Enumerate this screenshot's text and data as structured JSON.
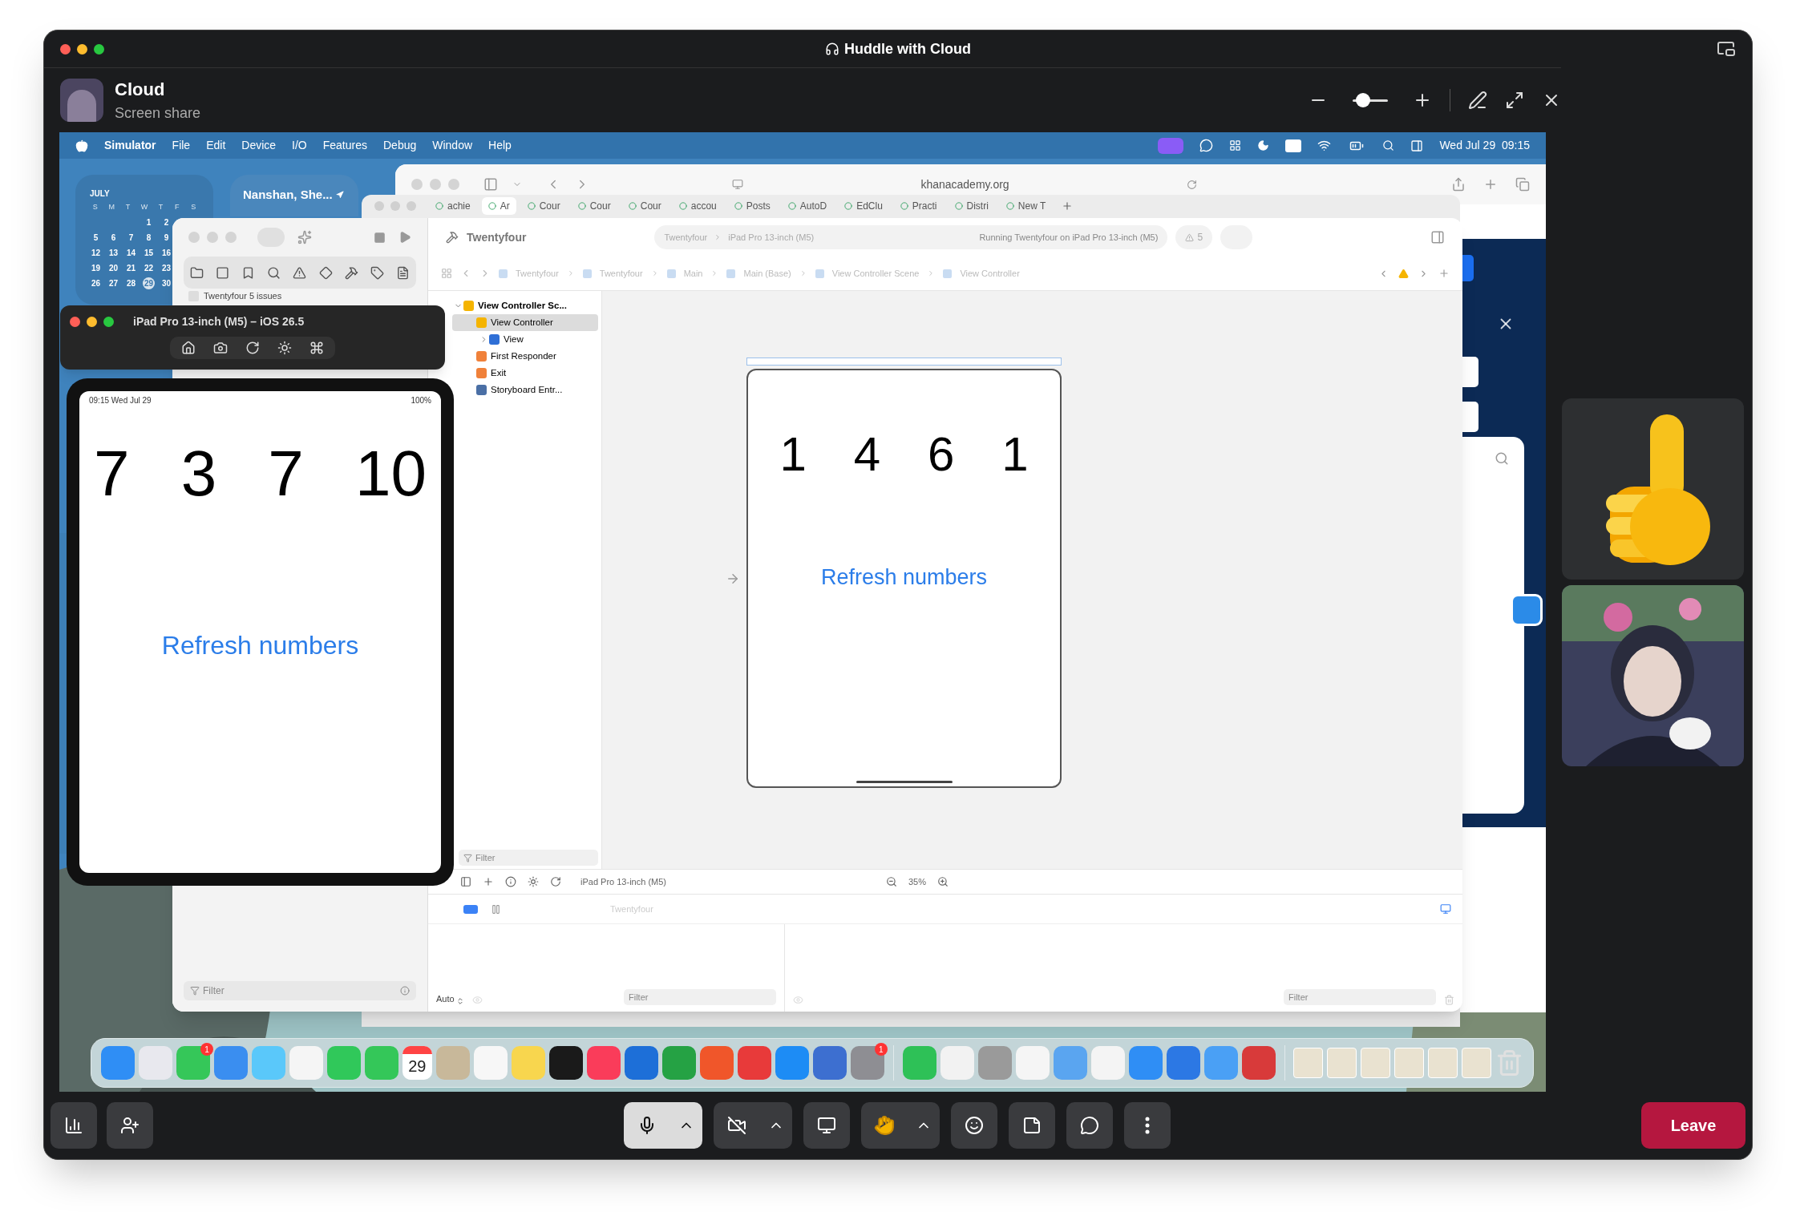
{
  "window": {
    "title": "Huddle with Cloud"
  },
  "presenter": {
    "name": "Cloud",
    "status": "Screen share"
  },
  "zoom_slider": {
    "level": 0.3
  },
  "shared_screen": {
    "menu_bar": {
      "app": "Simulator",
      "menus": [
        "File",
        "Edit",
        "Device",
        "I/O",
        "Features",
        "Debug",
        "Window",
        "Help"
      ],
      "clock": "Wed Jul 29  09:15"
    },
    "calendar_widget": {
      "month": "JULY",
      "weekdays": [
        "S",
        "M",
        "T",
        "W",
        "T",
        "F",
        "S"
      ],
      "weeks": [
        [
          {
            "day": "1",
            "selected": false
          },
          {
            "day": "2",
            "selected": false
          }
        ],
        [
          {
            "day": "5",
            "selected": false
          },
          {
            "day": "6",
            "selected": false
          },
          {
            "day": "7",
            "selected": false
          },
          {
            "day": "8",
            "selected": false
          },
          {
            "day": "9",
            "selected": false
          }
        ],
        [
          {
            "day": "12",
            "selected": false
          },
          {
            "day": "13",
            "selected": false
          },
          {
            "day": "14",
            "selected": false
          },
          {
            "day": "15",
            "selected": false
          },
          {
            "day": "16",
            "selected": false
          }
        ],
        [
          {
            "day": "19",
            "selected": false
          },
          {
            "day": "20",
            "selected": false
          },
          {
            "day": "21",
            "selected": false
          },
          {
            "day": "22",
            "selected": false
          },
          {
            "day": "23",
            "selected": false
          }
        ],
        [
          {
            "day": "26",
            "selected": false
          },
          {
            "day": "27",
            "selected": false
          },
          {
            "day": "28",
            "selected": false
          },
          {
            "day": "29",
            "selected": true
          },
          {
            "day": "30",
            "selected": false
          }
        ]
      ]
    },
    "weather_widget": {
      "location": "Nanshan, She..."
    },
    "safari": {
      "url": "khanacademy.org"
    },
    "tab_window": {
      "tabs": [
        {
          "label": "achie",
          "selected": false
        },
        {
          "label": "Ar",
          "selected": true
        },
        {
          "label": "Cour",
          "selected": false
        },
        {
          "label": "Cour",
          "selected": false
        },
        {
          "label": "Cour",
          "selected": false
        },
        {
          "label": "accou",
          "selected": false
        },
        {
          "label": "Posts",
          "selected": false
        },
        {
          "label": "AutoD",
          "selected": false
        },
        {
          "label": "EdClu",
          "selected": false
        },
        {
          "label": "Practi",
          "selected": false
        },
        {
          "label": "Distri",
          "selected": false
        },
        {
          "label": "New T",
          "selected": false
        }
      ]
    },
    "xcode": {
      "project": "Twentyfour",
      "scheme": "Twentyfour",
      "device": "iPad Pro 13-inch (M5)",
      "status": "Running Twentyfour on iPad Pro 13-inch (M5)",
      "warnings": "5",
      "issues": {
        "project": "Twentyfour",
        "summary": "5 issues"
      },
      "breadcrumbs": [
        "Twentyfour",
        "Twentyfour",
        "Main",
        "Main (Base)",
        "View Controller Scene",
        "View Controller"
      ],
      "outline": [
        {
          "label": "View Controller Sc...",
          "kind": "scene",
          "expanded": true,
          "selected": false,
          "children": [
            {
              "label": "View Controller",
              "kind": "controller",
              "selected": true,
              "children": [
                {
                  "label": "View",
                  "kind": "view",
                  "expanded": false,
                  "selected": false
                }
              ]
            },
            {
              "label": "First Responder",
              "kind": "responder",
              "selected": false
            },
            {
              "label": "Exit",
              "kind": "exit",
              "selected": false
            },
            {
              "label": "Storyboard Entr...",
              "kind": "entry",
              "selected": false
            }
          ]
        }
      ],
      "outline_filter": "Filter",
      "canvas": {
        "numbers": [
          "1",
          "4",
          "6",
          "1"
        ],
        "button": "Refresh numbers"
      },
      "canvas_bar": {
        "device": "iPad Pro 13-inch (M5)",
        "zoom": "35%"
      },
      "debug_bar": {
        "breakpoints_on": true,
        "target": "Twentyfour"
      },
      "debug_footer": {
        "mode": "Auto",
        "variables_filter": "Filter",
        "console_filter": "Filter"
      },
      "navigator_filter": "Filter"
    },
    "simulator": {
      "title": "iPad Pro 13-inch (M5) – iOS 26.5",
      "time": "09:15",
      "date": "Wed Jul 29",
      "battery": "100%",
      "numbers": [
        "7",
        "3",
        "7",
        "10"
      ],
      "button": "Refresh numbers"
    },
    "dock": {
      "apps": [
        {
          "kind": "app"
        },
        {
          "kind": "app"
        },
        {
          "kind": "app",
          "badge": "1"
        },
        {
          "kind": "app"
        },
        {
          "kind": "app"
        },
        {
          "kind": "app"
        },
        {
          "kind": "app"
        },
        {
          "kind": "app"
        },
        {
          "kind": "calendar",
          "day": "29"
        },
        {
          "kind": "app"
        },
        {
          "kind": "app"
        },
        {
          "kind": "app"
        },
        {
          "kind": "app"
        },
        {
          "kind": "app"
        },
        {
          "kind": "app"
        },
        {
          "kind": "app"
        },
        {
          "kind": "app"
        },
        {
          "kind": "app"
        },
        {
          "kind": "app"
        },
        {
          "kind": "app"
        },
        {
          "kind": "app",
          "badge": "1"
        },
        {
          "kind": "separator"
        },
        {
          "kind": "app"
        },
        {
          "kind": "app"
        },
        {
          "kind": "app"
        },
        {
          "kind": "app"
        },
        {
          "kind": "app"
        },
        {
          "kind": "app"
        },
        {
          "kind": "app"
        },
        {
          "kind": "app"
        },
        {
          "kind": "app"
        },
        {
          "kind": "app"
        },
        {
          "kind": "separator"
        },
        {
          "kind": "folder"
        },
        {
          "kind": "folder"
        },
        {
          "kind": "folder"
        },
        {
          "kind": "folder"
        },
        {
          "kind": "folder"
        },
        {
          "kind": "folder"
        },
        {
          "kind": "trash"
        }
      ]
    }
  },
  "controls": {
    "microphone_on": true,
    "camera_on": false,
    "leave": "Leave"
  }
}
